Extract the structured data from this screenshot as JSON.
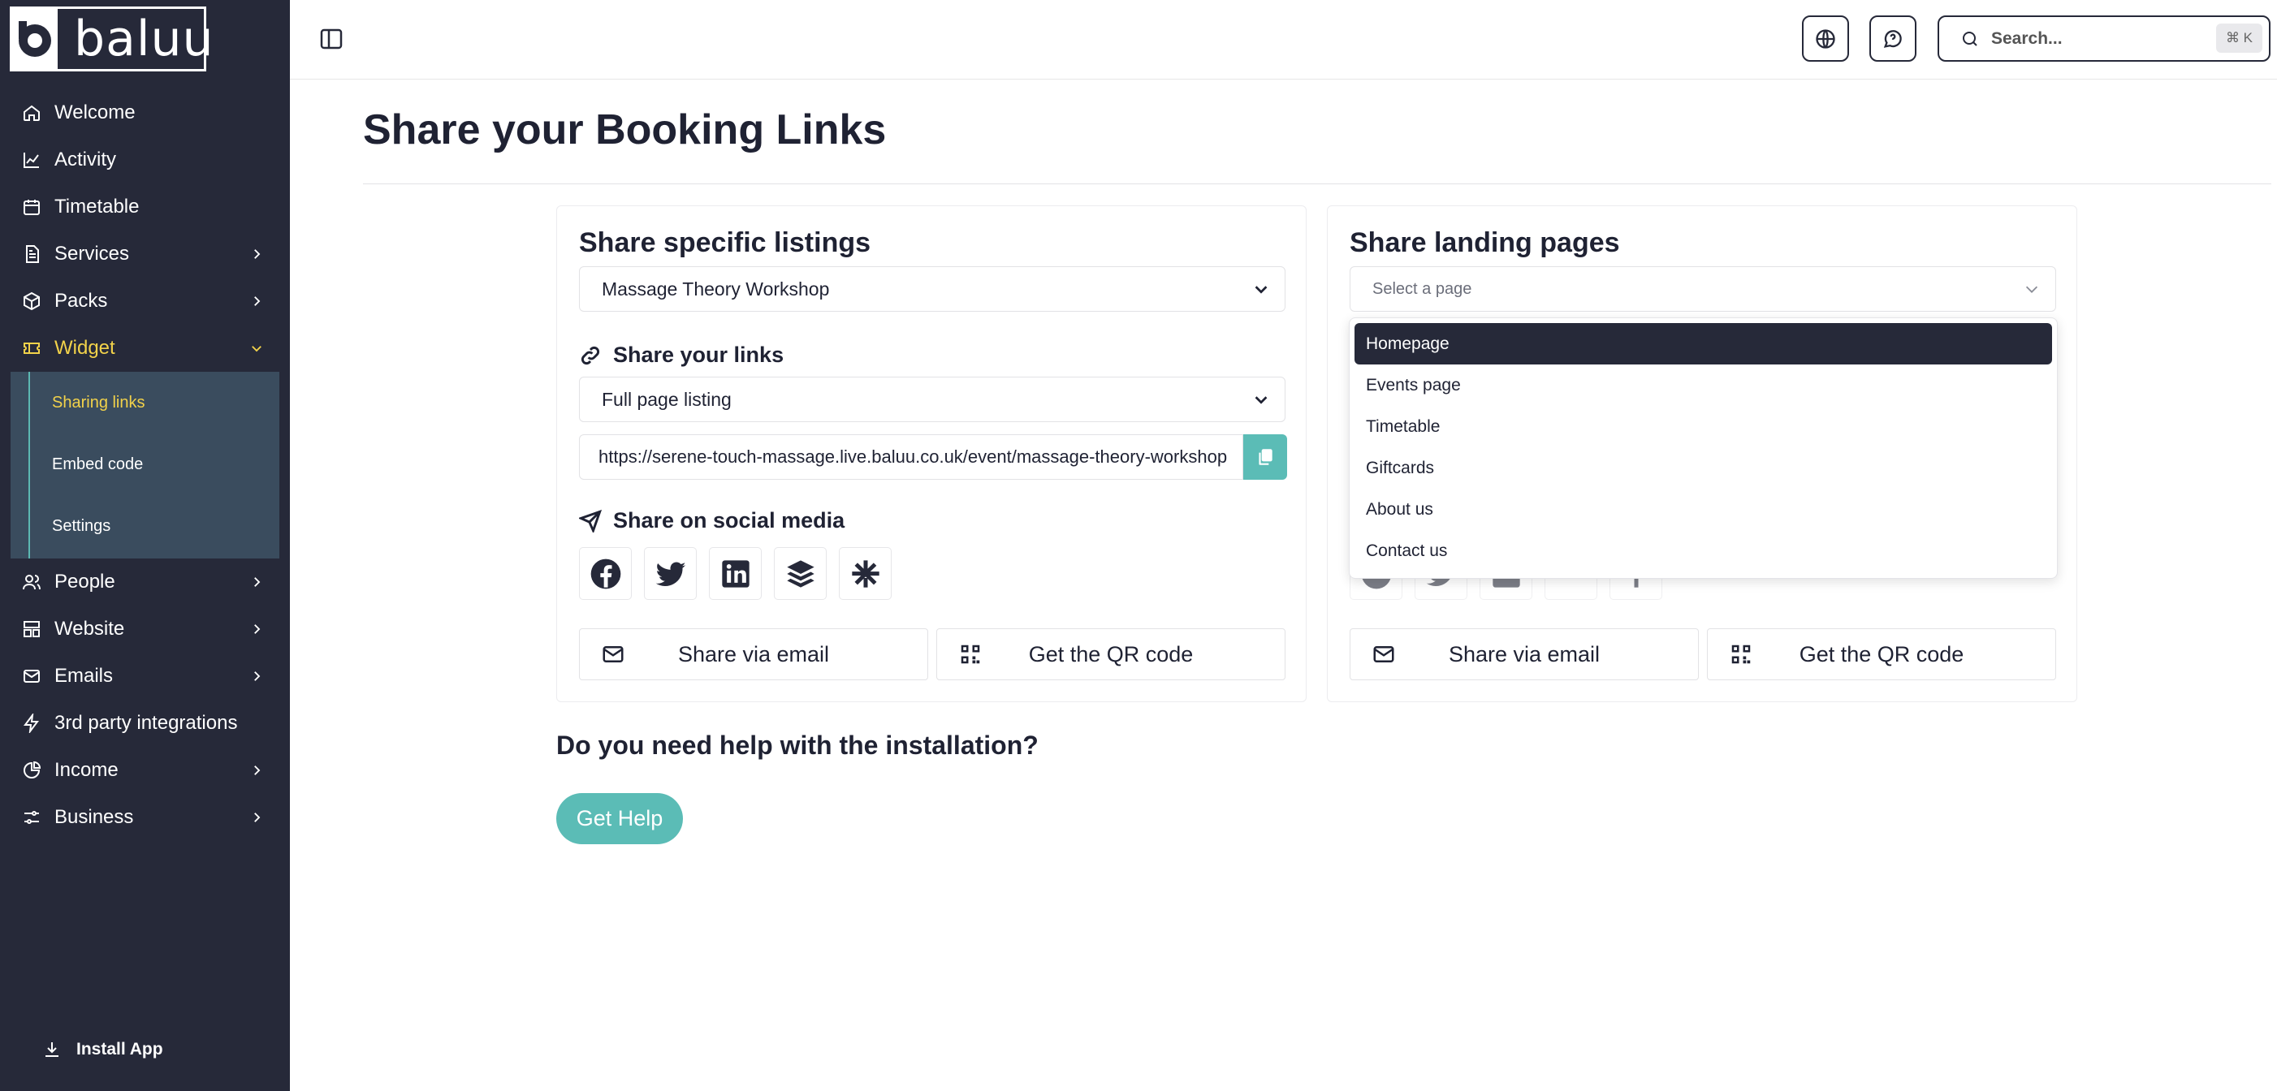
{
  "app": {
    "brand": "baluu"
  },
  "sidebar": {
    "items": [
      {
        "label": "Welcome",
        "icon": "home-icon",
        "chevron": false
      },
      {
        "label": "Activity",
        "icon": "activity-chart-icon",
        "chevron": false
      },
      {
        "label": "Timetable",
        "icon": "calendar-icon",
        "chevron": false
      },
      {
        "label": "Services",
        "icon": "document-icon",
        "chevron": true
      },
      {
        "label": "Packs",
        "icon": "box-icon",
        "chevron": true
      },
      {
        "label": "Widget",
        "icon": "ticket-icon",
        "chevron": true,
        "expanded": true
      }
    ],
    "subitems": [
      {
        "label": "Sharing links",
        "active": true
      },
      {
        "label": "Embed code",
        "active": false
      },
      {
        "label": "Settings",
        "active": false
      }
    ],
    "items_after": [
      {
        "label": "People",
        "icon": "people-icon",
        "chevron": true
      },
      {
        "label": "Website",
        "icon": "layout-icon",
        "chevron": true
      },
      {
        "label": "Emails",
        "icon": "mail-icon",
        "chevron": true
      },
      {
        "label": "3rd party integrations",
        "icon": "lightning-icon",
        "chevron": false
      },
      {
        "label": "Income",
        "icon": "pie-chart-icon",
        "chevron": true
      },
      {
        "label": "Business",
        "icon": "sliders-icon",
        "chevron": true
      }
    ],
    "install": "Install App"
  },
  "topbar": {
    "search_placeholder": "Search...",
    "shortcut": "⌘ K"
  },
  "page": {
    "title": "Share your Booking Links"
  },
  "left_card": {
    "title": "Share specific listings",
    "listing_value": "Massage Theory Workshop",
    "links_heading": "Share your links",
    "link_type_value": "Full page listing",
    "url": "https://serene-touch-massage.live.baluu.co.uk/event/massage-theory-workshop",
    "social_heading": "Share on social media",
    "socials": [
      "facebook-icon",
      "twitter-icon",
      "linkedin-icon",
      "buffer-icon",
      "linktree-icon"
    ],
    "email_label": "Share via email",
    "qr_label": "Get the QR code"
  },
  "right_card": {
    "title": "Share landing pages",
    "select_placeholder": "Select a page",
    "email_label": "Share via email",
    "qr_label": "Get the QR code",
    "menu_options": [
      "Homepage",
      "Events page",
      "Timetable",
      "Giftcards",
      "About us",
      "Contact us"
    ],
    "menu_highlighted": "Homepage"
  },
  "help": {
    "question": "Do you need help with the installation?",
    "button": "Get Help"
  },
  "colors": {
    "sidebar_bg": "#262939",
    "active_yellow": "#f2d24a",
    "submenu_bg": "#3a4c5e",
    "accent_teal": "#5bbcb6"
  }
}
